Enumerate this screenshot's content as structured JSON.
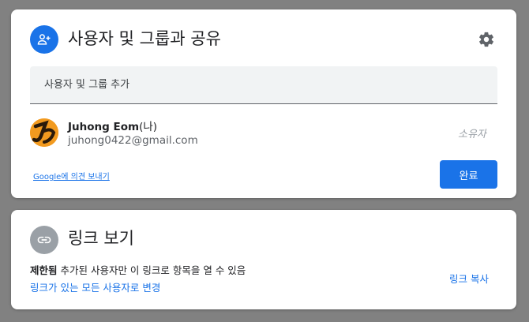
{
  "share": {
    "title": "사용자 및 그룹과 공유",
    "add_placeholder": "사용자 및 그룹 추가",
    "user": {
      "name": "Juhong Eom",
      "me_suffix": "(나)",
      "email": "juhong0422@gmail.com",
      "role": "소유자"
    },
    "feedback_link": "Google에 의견 보내기",
    "done_label": "완료"
  },
  "link": {
    "title": "링크 보기",
    "restriction_label": "제한됨",
    "restriction_text": " 추가된 사용자만 이 링크로 항목을 열 수 있음",
    "change_link": "링크가 있는 모든 사용자로 변경",
    "copy_label": "링크 복사"
  },
  "colors": {
    "accent": "#1a73e8",
    "backdrop": "#818181",
    "link_icon_bg": "#9aa0a6"
  }
}
